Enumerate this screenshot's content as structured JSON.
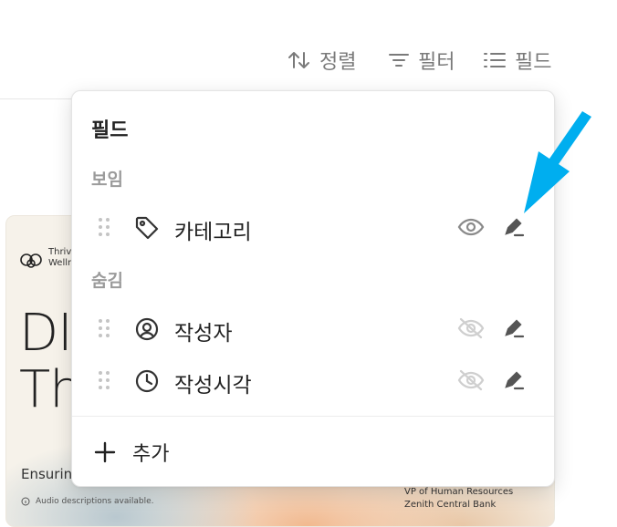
{
  "toolbar": {
    "sort_label": "정렬",
    "filter_label": "필터",
    "fields_label": "필드"
  },
  "card": {
    "brand_line1": "Thriv",
    "brand_line2": "Welln",
    "title_line1": "DI",
    "title_line2": "Th",
    "subtitle": "Ensuring",
    "audio": "Audio descriptions available.",
    "person_role": "VP of Human Resources",
    "person_org": "Zenith Central Bank"
  },
  "popover": {
    "title": "필드",
    "visible_section": "보임",
    "hidden_section": "숨김",
    "visible_fields": [
      {
        "label": "카테고리",
        "icon": "tag-icon"
      }
    ],
    "hidden_fields": [
      {
        "label": "작성자",
        "icon": "user-circle-icon"
      },
      {
        "label": "작성시각",
        "icon": "clock-icon"
      }
    ],
    "add_label": "추가"
  },
  "colors": {
    "annotation_arrow": "#00aeef",
    "muted": "#9b9b9b"
  }
}
